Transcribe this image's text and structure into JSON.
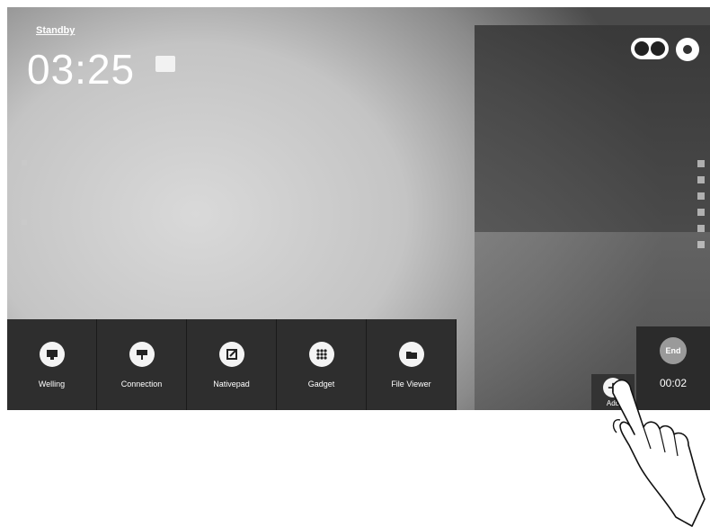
{
  "status": {
    "label": "Standby"
  },
  "clock": {
    "time": "03:25",
    "date_text": ""
  },
  "top_icons": [
    "user-toggle-icon",
    "settings-gear-icon"
  ],
  "dock": {
    "items": [
      {
        "label": "Welling",
        "icon": "monitor-icon"
      },
      {
        "label": "Connection",
        "icon": "cast-icon"
      },
      {
        "label": "Nativepad",
        "icon": "edit-note-icon"
      },
      {
        "label": "Gadget",
        "icon": "apps-grid-icon"
      },
      {
        "label": "File Viewer",
        "icon": "folder-icon"
      }
    ]
  },
  "add_button": {
    "label": "Add"
  },
  "timer": {
    "end_label": "End",
    "time": "00:02"
  }
}
